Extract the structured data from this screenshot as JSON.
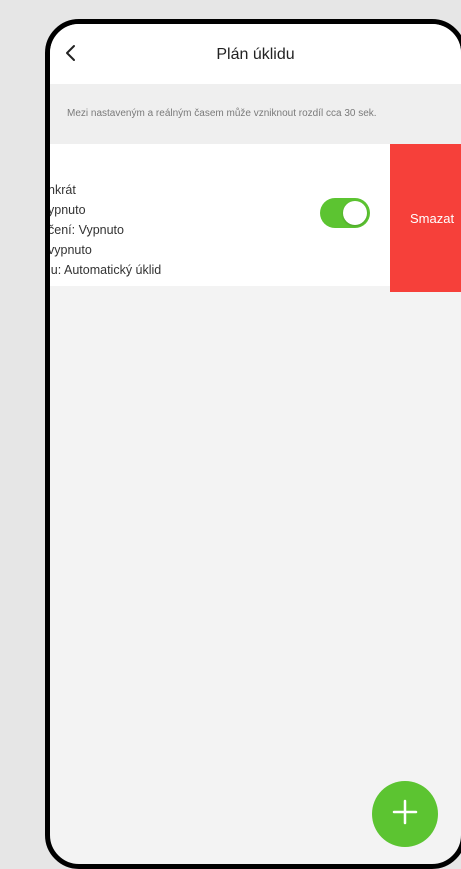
{
  "header": {
    "title": "Plán úklidu",
    "back_icon": "chevron-left-icon"
  },
  "notice": {
    "text": "Mezi nastaveným a reálným časem může vzniknout rozdíl cca 30 sek."
  },
  "schedule_row": {
    "lines": [
      "nkrát",
      "ypnuto",
      "čení: Vypnuto",
      "vypnuto",
      "lu: Automatický úklid"
    ],
    "toggle_on": true,
    "delete_label": "Smazat"
  },
  "fab": {
    "icon": "plus-icon"
  },
  "colors": {
    "accent_green": "#5cc431",
    "delete_red": "#f6403a",
    "background": "#f3f3f3"
  }
}
